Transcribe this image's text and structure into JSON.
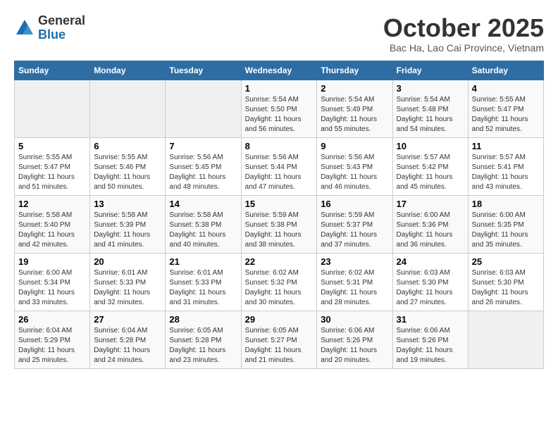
{
  "header": {
    "logo_general": "General",
    "logo_blue": "Blue",
    "month_title": "October 2025",
    "location": "Bac Ha, Lao Cai Province, Vietnam"
  },
  "days_of_week": [
    "Sunday",
    "Monday",
    "Tuesday",
    "Wednesday",
    "Thursday",
    "Friday",
    "Saturday"
  ],
  "weeks": [
    [
      {
        "day": "",
        "empty": true
      },
      {
        "day": "",
        "empty": true
      },
      {
        "day": "",
        "empty": true
      },
      {
        "day": "1",
        "sunrise": "5:54 AM",
        "sunset": "5:50 PM",
        "daylight": "11 hours and 56 minutes."
      },
      {
        "day": "2",
        "sunrise": "5:54 AM",
        "sunset": "5:49 PM",
        "daylight": "11 hours and 55 minutes."
      },
      {
        "day": "3",
        "sunrise": "5:54 AM",
        "sunset": "5:48 PM",
        "daylight": "11 hours and 54 minutes."
      },
      {
        "day": "4",
        "sunrise": "5:55 AM",
        "sunset": "5:47 PM",
        "daylight": "11 hours and 52 minutes."
      }
    ],
    [
      {
        "day": "5",
        "sunrise": "5:55 AM",
        "sunset": "5:47 PM",
        "daylight": "11 hours and 51 minutes."
      },
      {
        "day": "6",
        "sunrise": "5:55 AM",
        "sunset": "5:46 PM",
        "daylight": "11 hours and 50 minutes."
      },
      {
        "day": "7",
        "sunrise": "5:56 AM",
        "sunset": "5:45 PM",
        "daylight": "11 hours and 48 minutes."
      },
      {
        "day": "8",
        "sunrise": "5:56 AM",
        "sunset": "5:44 PM",
        "daylight": "11 hours and 47 minutes."
      },
      {
        "day": "9",
        "sunrise": "5:56 AM",
        "sunset": "5:43 PM",
        "daylight": "11 hours and 46 minutes."
      },
      {
        "day": "10",
        "sunrise": "5:57 AM",
        "sunset": "5:42 PM",
        "daylight": "11 hours and 45 minutes."
      },
      {
        "day": "11",
        "sunrise": "5:57 AM",
        "sunset": "5:41 PM",
        "daylight": "11 hours and 43 minutes."
      }
    ],
    [
      {
        "day": "12",
        "sunrise": "5:58 AM",
        "sunset": "5:40 PM",
        "daylight": "11 hours and 42 minutes."
      },
      {
        "day": "13",
        "sunrise": "5:58 AM",
        "sunset": "5:39 PM",
        "daylight": "11 hours and 41 minutes."
      },
      {
        "day": "14",
        "sunrise": "5:58 AM",
        "sunset": "5:38 PM",
        "daylight": "11 hours and 40 minutes."
      },
      {
        "day": "15",
        "sunrise": "5:59 AM",
        "sunset": "5:38 PM",
        "daylight": "11 hours and 38 minutes."
      },
      {
        "day": "16",
        "sunrise": "5:59 AM",
        "sunset": "5:37 PM",
        "daylight": "11 hours and 37 minutes."
      },
      {
        "day": "17",
        "sunrise": "6:00 AM",
        "sunset": "5:36 PM",
        "daylight": "11 hours and 36 minutes."
      },
      {
        "day": "18",
        "sunrise": "6:00 AM",
        "sunset": "5:35 PM",
        "daylight": "11 hours and 35 minutes."
      }
    ],
    [
      {
        "day": "19",
        "sunrise": "6:00 AM",
        "sunset": "5:34 PM",
        "daylight": "11 hours and 33 minutes."
      },
      {
        "day": "20",
        "sunrise": "6:01 AM",
        "sunset": "5:33 PM",
        "daylight": "11 hours and 32 minutes."
      },
      {
        "day": "21",
        "sunrise": "6:01 AM",
        "sunset": "5:33 PM",
        "daylight": "11 hours and 31 minutes."
      },
      {
        "day": "22",
        "sunrise": "6:02 AM",
        "sunset": "5:32 PM",
        "daylight": "11 hours and 30 minutes."
      },
      {
        "day": "23",
        "sunrise": "6:02 AM",
        "sunset": "5:31 PM",
        "daylight": "11 hours and 28 minutes."
      },
      {
        "day": "24",
        "sunrise": "6:03 AM",
        "sunset": "5:30 PM",
        "daylight": "11 hours and 27 minutes."
      },
      {
        "day": "25",
        "sunrise": "6:03 AM",
        "sunset": "5:30 PM",
        "daylight": "11 hours and 26 minutes."
      }
    ],
    [
      {
        "day": "26",
        "sunrise": "6:04 AM",
        "sunset": "5:29 PM",
        "daylight": "11 hours and 25 minutes."
      },
      {
        "day": "27",
        "sunrise": "6:04 AM",
        "sunset": "5:28 PM",
        "daylight": "11 hours and 24 minutes."
      },
      {
        "day": "28",
        "sunrise": "6:05 AM",
        "sunset": "5:28 PM",
        "daylight": "11 hours and 23 minutes."
      },
      {
        "day": "29",
        "sunrise": "6:05 AM",
        "sunset": "5:27 PM",
        "daylight": "11 hours and 21 minutes."
      },
      {
        "day": "30",
        "sunrise": "6:06 AM",
        "sunset": "5:26 PM",
        "daylight": "11 hours and 20 minutes."
      },
      {
        "day": "31",
        "sunrise": "6:06 AM",
        "sunset": "5:26 PM",
        "daylight": "11 hours and 19 minutes."
      },
      {
        "day": "",
        "empty": true
      }
    ]
  ],
  "labels": {
    "sunrise": "Sunrise:",
    "sunset": "Sunset:",
    "daylight": "Daylight:"
  }
}
